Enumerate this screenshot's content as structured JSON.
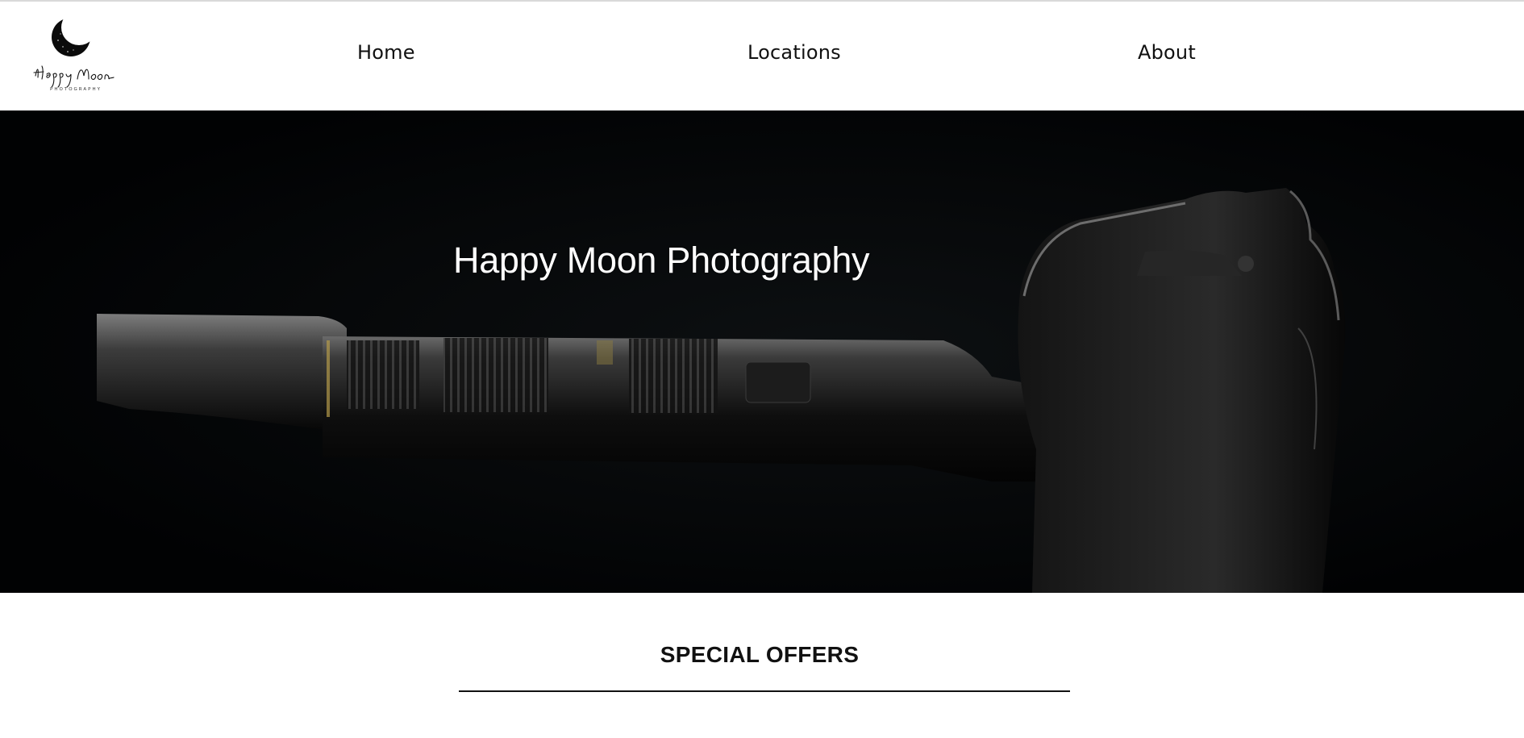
{
  "brand": {
    "script_name": "Happy Moon",
    "tagline": "PHOTOGRAPHY"
  },
  "nav": {
    "items": [
      {
        "label": "Home"
      },
      {
        "label": "Locations"
      },
      {
        "label": "About"
      }
    ]
  },
  "hero": {
    "title": "Happy Moon Photography"
  },
  "offers": {
    "title": "SPECIAL OFFERS"
  },
  "colors": {
    "background": "#ffffff",
    "hero_background": "#020304",
    "text": "#111111",
    "hero_text": "#ffffff"
  }
}
